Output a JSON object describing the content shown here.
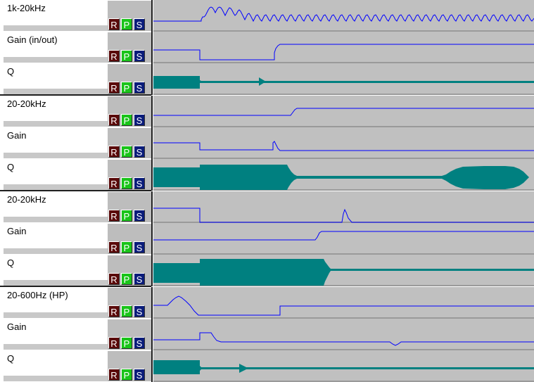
{
  "colors": {
    "line": "#0000ff",
    "q_fill": "#008080",
    "lane_bg": "#c0c0c0",
    "button_r": "#5a0a0a",
    "button_p": "#19c419",
    "button_s": "#0a1c7a"
  },
  "buttons": {
    "r": "R",
    "p": "P",
    "s": "S"
  },
  "tracks": [
    {
      "label": "1k-20kHz"
    },
    {
      "label": "Gain (in/out)"
    },
    {
      "label": "Q"
    },
    {
      "label": "20-20kHz"
    },
    {
      "label": "Gain"
    },
    {
      "label": "Q"
    },
    {
      "label": "20-20kHz"
    },
    {
      "label": "Gain"
    },
    {
      "label": "Q"
    },
    {
      "label": "20-600Hz (HP)"
    },
    {
      "label": "Gain"
    },
    {
      "label": "Q"
    }
  ]
}
